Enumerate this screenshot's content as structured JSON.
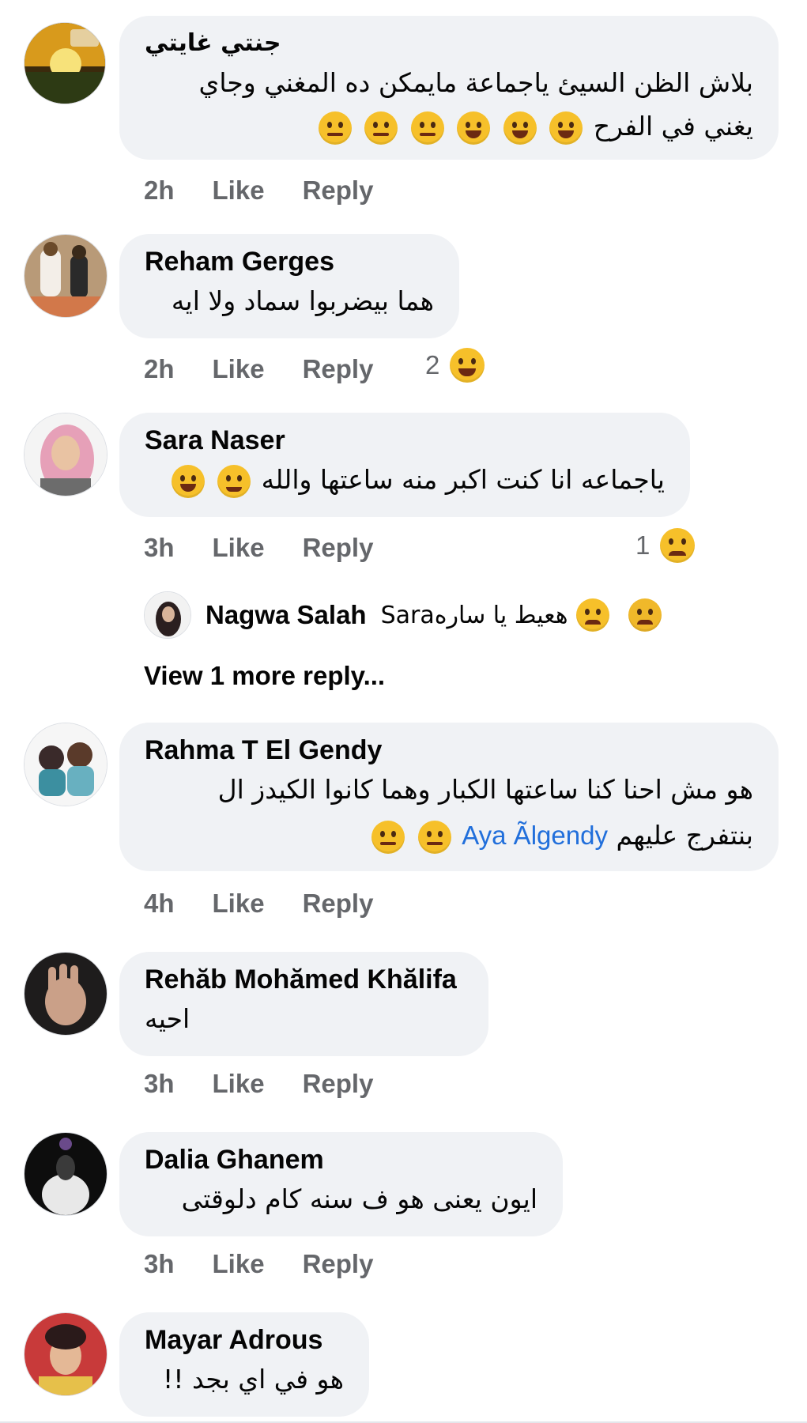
{
  "comments": [
    {
      "name": "جنتي غايتي",
      "lines": [
        "بلاش الظن السيئ ياجماعة مايمكن ده المغني وجاي",
        "يغني في الفرح"
      ],
      "time": "2h",
      "like": "Like",
      "reply": "Reply"
    },
    {
      "name": "Reham Gerges",
      "text": "هما بيضربوا سماد ولا ايه",
      "time": "2h",
      "like": "Like",
      "reply": "Reply",
      "reaction_count": "2"
    },
    {
      "name": "Sara Naser",
      "text": "ياجماعه انا كنت اكبر منه ساعتها والله",
      "time": "3h",
      "like": "Like",
      "reply": "Reply",
      "reaction_count": "1",
      "reply_preview": {
        "name": "Nagwa Salah",
        "text": "Saraهعيط يا ساره"
      },
      "view_more": "View 1 more reply..."
    },
    {
      "name": "Rahma T El Gendy",
      "lines": [
        "هو مش احنا كنا ساعتها الكبار وهما كانوا الكيدز ال",
        "بنتفرج عليهم"
      ],
      "mention": "Aya Ãlgendy",
      "time": "4h",
      "like": "Like",
      "reply": "Reply"
    },
    {
      "name": "Rehăb Mohămed Khălifa",
      "text": "احيه",
      "time": "3h",
      "like": "Like",
      "reply": "Reply"
    },
    {
      "name": "Dalia Ghanem",
      "text": "ايون يعنى هو ف سنه كام دلوقتى",
      "time": "3h",
      "like": "Like",
      "reply": "Reply"
    },
    {
      "name": "Mayar Adrous",
      "text": "هو في اي بجد !!"
    }
  ]
}
